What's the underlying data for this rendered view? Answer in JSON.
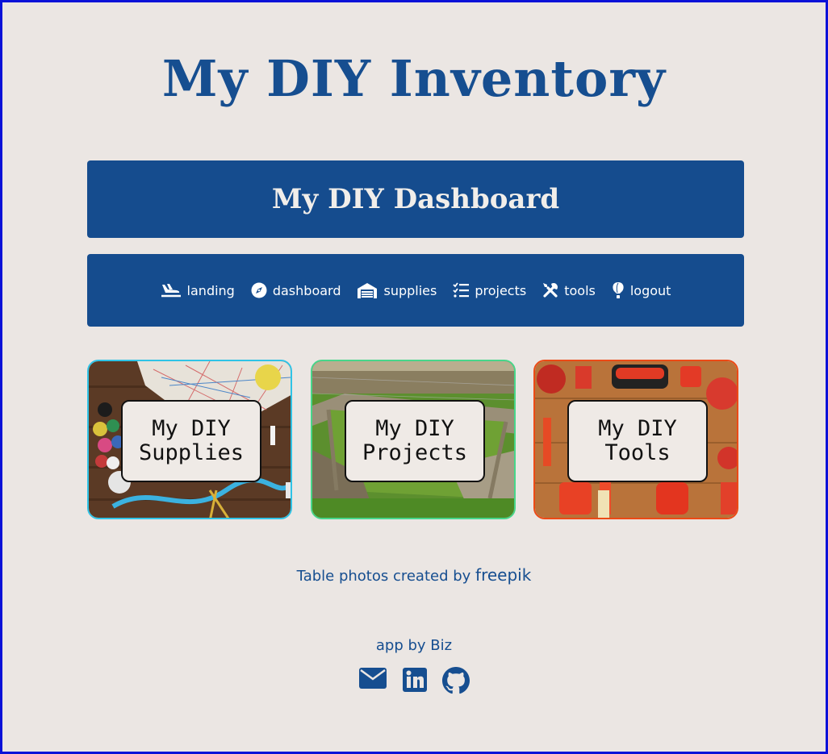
{
  "header": {
    "title": "My DIY Inventory"
  },
  "banner": {
    "title": "My DIY Dashboard"
  },
  "nav": {
    "items": [
      {
        "label": "landing",
        "icon": "plane-landing-icon"
      },
      {
        "label": "dashboard",
        "icon": "compass-icon"
      },
      {
        "label": "supplies",
        "icon": "warehouse-icon"
      },
      {
        "label": "projects",
        "icon": "tasks-list-icon"
      },
      {
        "label": "tools",
        "icon": "tools-icon"
      },
      {
        "label": "logout",
        "icon": "hot-air-balloon-icon"
      }
    ]
  },
  "cards": [
    {
      "title": "My DIY Supplies",
      "line1": "My DIY",
      "line2": "Supplies",
      "border": "#2fc3e6"
    },
    {
      "title": "My DIY Projects",
      "line1": "My DIY",
      "line2": "Projects",
      "border": "#47d68a"
    },
    {
      "title": "My DIY Tools",
      "line1": "My DIY",
      "line2": "Tools",
      "border": "#ec4a16"
    }
  ],
  "credit": {
    "prefix": "Table photos created by ",
    "link": "freepik"
  },
  "footer": {
    "byline": "app by Biz",
    "icons": [
      "envelope-icon",
      "linkedin-icon",
      "github-icon"
    ]
  },
  "colors": {
    "primary": "#154c8e",
    "background": "#ebe6e3",
    "frame": "#0a12d8"
  }
}
